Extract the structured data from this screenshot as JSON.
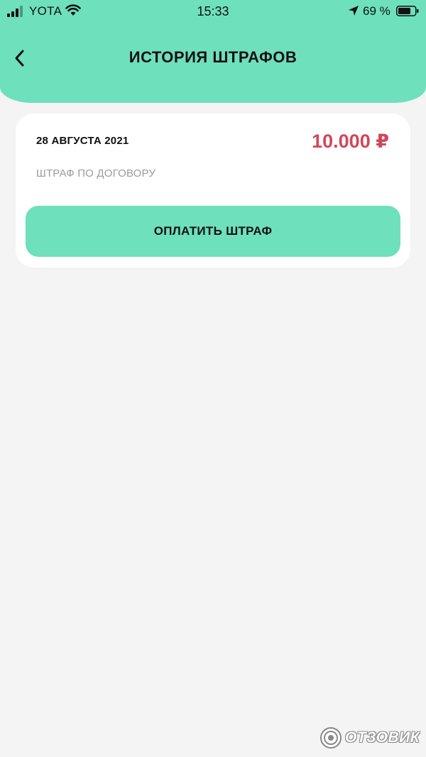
{
  "status_bar": {
    "carrier": "YOTA",
    "time": "15:33",
    "battery": "69 %",
    "icons": [
      "signal-icon",
      "wifi-icon",
      "location-arrow-icon",
      "battery-icon"
    ]
  },
  "header": {
    "title": "ИСТОРИЯ ШТРАФОВ",
    "back_icon": "chevron-left-icon"
  },
  "fines": [
    {
      "date": "28 АВГУСТА 2021",
      "amount": "10.000 ₽",
      "description": "ШТРАФ ПО ДОГОВОРУ",
      "pay_label": "ОПЛАТИТЬ ШТРАФ"
    }
  ],
  "watermark": {
    "text": "ОТЗОВИК"
  },
  "colors": {
    "accent": "#6ee0bb",
    "amount": "#d0475a",
    "background": "#f4f4f4",
    "card": "#ffffff",
    "muted_text": "#9a9a9a"
  }
}
